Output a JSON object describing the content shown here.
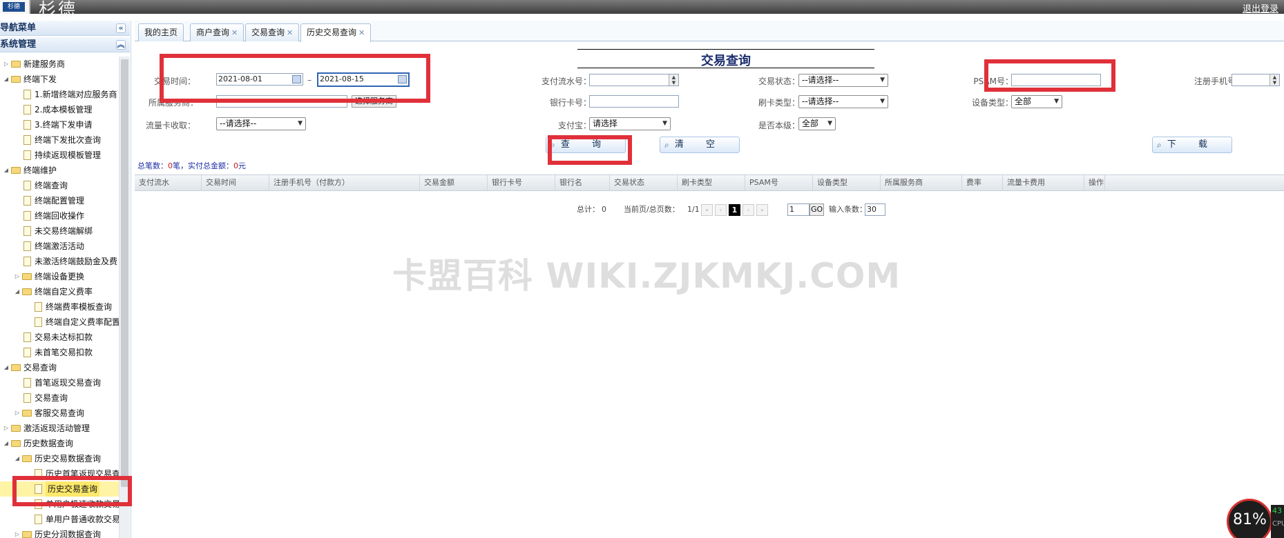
{
  "header": {
    "logo": "杉德",
    "brand": "杉德",
    "logout": "退出登录"
  },
  "sidebar": {
    "nav_title": "导航菜单",
    "section_title": "系统管理",
    "tree": [
      {
        "label": "新建服务商",
        "type": "folder",
        "level": 0,
        "state": "closed"
      },
      {
        "label": "终端下发",
        "type": "folder",
        "level": 0,
        "state": "open"
      },
      {
        "label": "1.新增终端对应服务商",
        "type": "doc",
        "level": 1
      },
      {
        "label": "2.成本模板管理",
        "type": "doc",
        "level": 1
      },
      {
        "label": "3.终端下发申请",
        "type": "doc",
        "level": 1
      },
      {
        "label": "终端下发批次查询",
        "type": "doc",
        "level": 1
      },
      {
        "label": "持续返现模板管理",
        "type": "doc",
        "level": 1
      },
      {
        "label": "终端维护",
        "type": "folder",
        "level": 0,
        "state": "open"
      },
      {
        "label": "终端查询",
        "type": "doc",
        "level": 1
      },
      {
        "label": "终端配置管理",
        "type": "doc",
        "level": 1
      },
      {
        "label": "终端回收操作",
        "type": "doc",
        "level": 1
      },
      {
        "label": "未交易终端解绑",
        "type": "doc",
        "level": 1
      },
      {
        "label": "终端激活活动",
        "type": "doc",
        "level": 1
      },
      {
        "label": "未激活终端鼓励金及费",
        "type": "doc",
        "level": 1
      },
      {
        "label": "终端设备更换",
        "type": "folder",
        "level": 1,
        "state": "closed"
      },
      {
        "label": "终端自定义费率",
        "type": "folder",
        "level": 1,
        "state": "open"
      },
      {
        "label": "终端费率模板查询",
        "type": "doc",
        "level": 2
      },
      {
        "label": "终端自定义费率配置",
        "type": "doc",
        "level": 2
      },
      {
        "label": "交易未达标扣款",
        "type": "doc",
        "level": 1
      },
      {
        "label": "未首笔交易扣款",
        "type": "doc",
        "level": 1
      },
      {
        "label": "交易查询",
        "type": "folder",
        "level": 0,
        "state": "open"
      },
      {
        "label": "首笔返现交易查询",
        "type": "doc",
        "level": 1
      },
      {
        "label": "交易查询",
        "type": "doc",
        "level": 1
      },
      {
        "label": "客服交易查询",
        "type": "folder",
        "level": 1,
        "state": "closed"
      },
      {
        "label": "激活返现活动管理",
        "type": "folder",
        "level": 0,
        "state": "closed"
      },
      {
        "label": "历史数据查询",
        "type": "folder",
        "level": 0,
        "state": "open"
      },
      {
        "label": "历史交易数据查询",
        "type": "folder",
        "level": 1,
        "state": "open"
      },
      {
        "label": "历史首笔返现交易查",
        "type": "doc",
        "level": 2
      },
      {
        "label": "历史交易查询",
        "type": "doc",
        "level": 2,
        "selected": true
      },
      {
        "label": "单用户极速收款交易",
        "type": "doc",
        "level": 2
      },
      {
        "label": "单用户普通收款交易",
        "type": "doc",
        "level": 2
      },
      {
        "label": "历史分润数据查询",
        "type": "folder",
        "level": 1,
        "state": "closed"
      }
    ]
  },
  "tabs": [
    {
      "label": "我的主页",
      "closable": false,
      "active": false
    },
    {
      "label": "商户查询",
      "closable": true,
      "active": false
    },
    {
      "label": "交易查询",
      "closable": true,
      "active": false
    },
    {
      "label": "历史交易查询",
      "closable": true,
      "active": true
    }
  ],
  "form": {
    "title": "交易查询",
    "trade_time_label": "交易时间：",
    "date_start": "2021-08-01",
    "date_sep": "–",
    "date_end": "2021-08-15",
    "service_label": "所属服务商：",
    "service_value": "",
    "choose_service_btn": "选择服务商",
    "flow_card_label": "流量卡收取：",
    "flow_card_value": "--请选择--",
    "pay_serial_label": "支付流水号：",
    "pay_serial_value": "",
    "bank_card_label": "银行卡号：",
    "bank_card_value": "",
    "alipay_label": "支付宝：",
    "alipay_value": "请选择",
    "trade_status_label": "交易状态：",
    "trade_status_value": "--请选择--",
    "card_type_label": "刷卡类型：",
    "card_type_value": "--请选择--",
    "own_level_label": "是否本级：",
    "own_level_value": "全部",
    "psam_label": "PSAM号：",
    "psam_value": "",
    "device_type_label": "设备类型：",
    "device_type_value": "全部",
    "phone_label": "注册手机号：",
    "phone_value": ""
  },
  "buttons": {
    "query": "查 询",
    "clear": "清 空",
    "download": "下 载"
  },
  "summary": {
    "prefix": "总笔数：",
    "count": "0",
    "mid": "笔，实付总金额：",
    "amount": "0",
    "suffix": "元"
  },
  "columns": [
    "支付流水",
    "交易时间",
    "注册手机号（付款方）",
    "交易金额",
    "银行卡号",
    "银行名",
    "交易状态",
    "刷卡类型",
    "PSAM号",
    "设备类型",
    "所属服务商",
    "费率",
    "流量卡费用",
    "操作"
  ],
  "pager": {
    "total_label": "总计：",
    "total": "0",
    "page_label": "当前页/总页数：",
    "page": "1/1",
    "current": "1",
    "goto_value": "1",
    "go_label": "GO",
    "size_label": "输入条数：",
    "size_value": "30"
  },
  "watermark": "卡盟百科  WIKI.ZJKMKJ.COM",
  "cpu": {
    "percent": "81%",
    "side_top": "43",
    "side_label": "CPU"
  },
  "colors": {
    "annotation_red": "#e0303a",
    "title_blue": "#1c2e6e"
  }
}
